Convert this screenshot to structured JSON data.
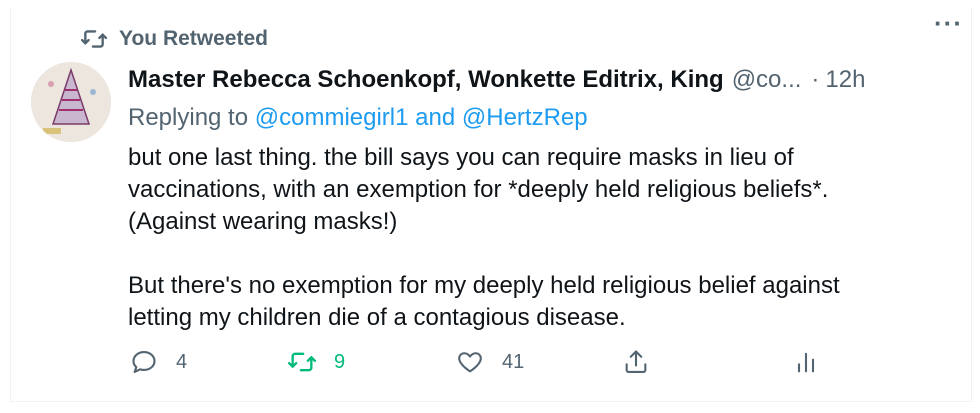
{
  "social_context": {
    "icon": "retweet-icon",
    "label": "You Retweeted"
  },
  "author": {
    "name": "Master Rebecca Schoenkopf, Wonkette Editrix, King",
    "handle": "@co...",
    "separator": "·",
    "time": "12h"
  },
  "more_label": "···",
  "reply": {
    "prefix": "Replying to",
    "mention1": "@commiegirl1",
    "conj": "and",
    "mention2": "@HertzRep"
  },
  "tweet_text": {
    "line1": "but one last thing. the bill says you can require masks in lieu of",
    "line2": "vaccinations, with an exemption for *deeply held religious beliefs*.",
    "line3": "(Against wearing masks!)",
    "para2_line1": "But there's no exemption for my deeply held religious belief against",
    "para2_line2": "letting my children die of a contagious disease."
  },
  "actions": {
    "reply_count": "4",
    "retweet_count": "9",
    "like_count": "41"
  },
  "colors": {
    "link": "#1d9bf0",
    "retweet_active": "#00ba7c",
    "secondary": "#536471"
  }
}
